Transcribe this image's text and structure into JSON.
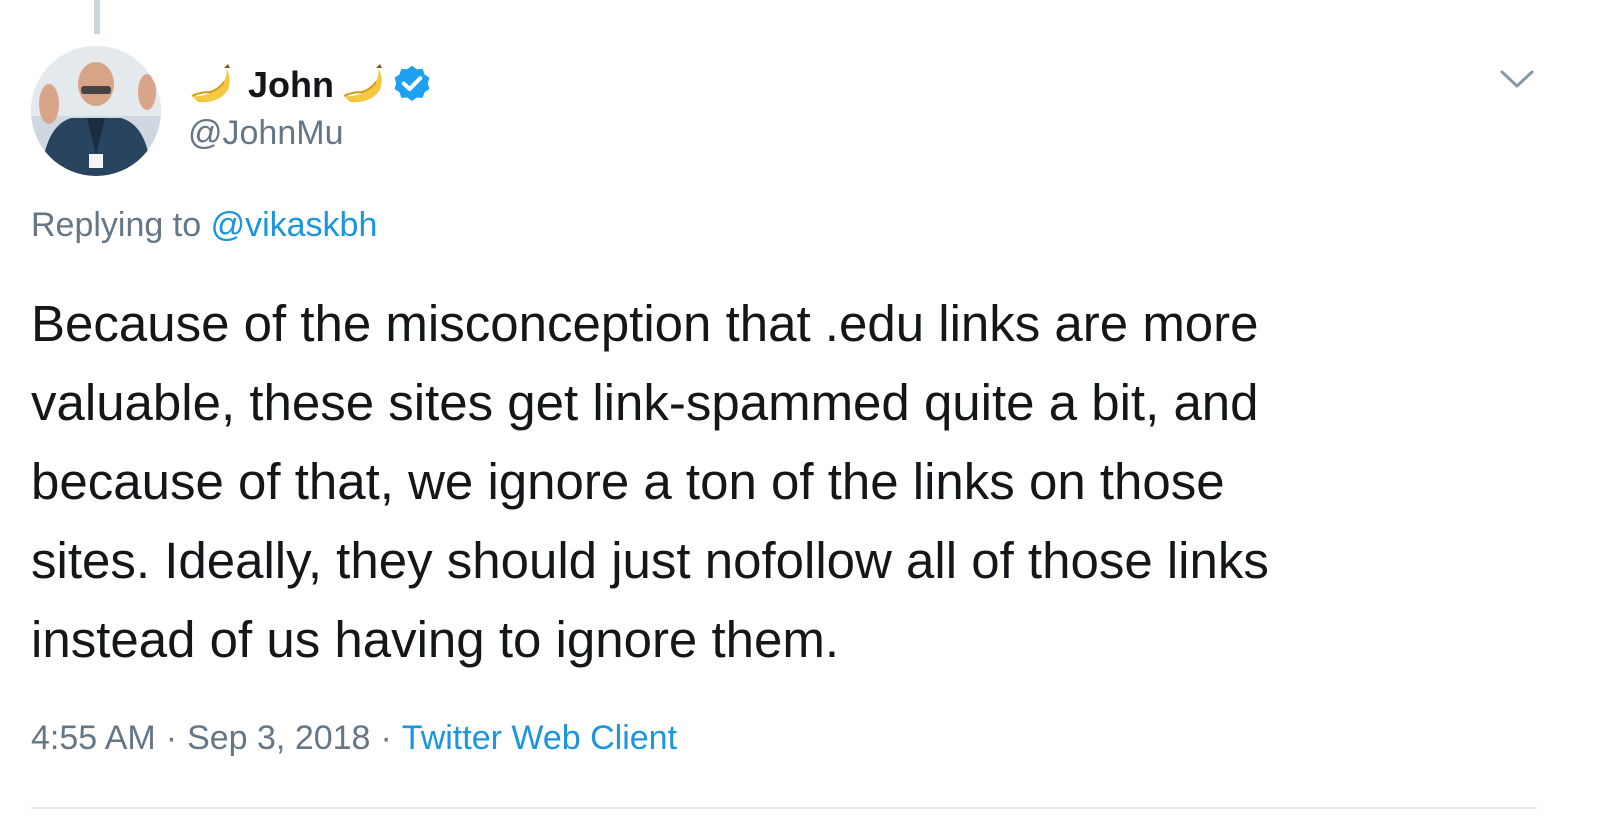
{
  "tweet": {
    "author": {
      "display_name": "John",
      "handle": "@JohnMu",
      "verified": true,
      "name_decoration_icons": [
        "banana-icon",
        "banana-icon"
      ]
    },
    "reply": {
      "prefix": "Replying to",
      "mention": "@vikaskbh"
    },
    "text_lines": [
      "Because of the misconception that .edu links are more",
      "valuable, these sites get link-spammed quite a bit, and",
      "because of that, we ignore a ton of the links on those",
      "sites. Ideally, they should just nofollow all of those links",
      "instead of us having to ignore them."
    ],
    "time": "4:55 AM",
    "separator": "·",
    "date": "Sep 3, 2018",
    "source": "Twitter Web Client"
  },
  "icons": {
    "caret": "chevron-down-icon",
    "verified": "verified-badge-icon"
  },
  "colors": {
    "link_blue": "#1b95e0",
    "verified_blue": "#1da1f2",
    "secondary_text": "#657786",
    "primary_text": "#14171a",
    "divider": "#e6ecf0"
  }
}
